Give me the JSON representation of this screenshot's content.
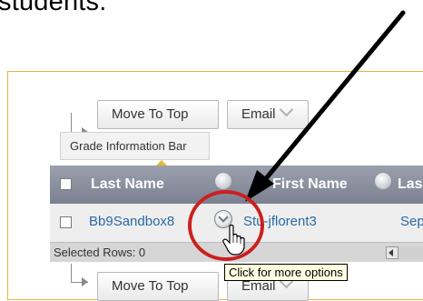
{
  "caption_partial": "students.",
  "toolbar_top": {
    "move_to_top": "Move To Top",
    "email": "Email"
  },
  "grade_info_bar": "Grade Information Bar",
  "grid": {
    "columns": [
      "Last Name",
      "First Name",
      "Las"
    ],
    "row": {
      "last_name": "Bb9Sandbox8",
      "first_name": "Stu-jflorent3",
      "next_col": "Sep"
    }
  },
  "selected_rows": "Selected Rows: 0",
  "tooltip": "Click for more options",
  "toolbar_bottom": {
    "move_to_top": "Move To Top",
    "email": "Email"
  },
  "colors": {
    "accent_red": "#cc1f1f",
    "arrow": "#000000",
    "frame_border": "#e3b441",
    "link": "#2a6aa8"
  },
  "icons": [
    "arrow-icon",
    "options-chevron-icon",
    "hand-cursor-icon"
  ]
}
